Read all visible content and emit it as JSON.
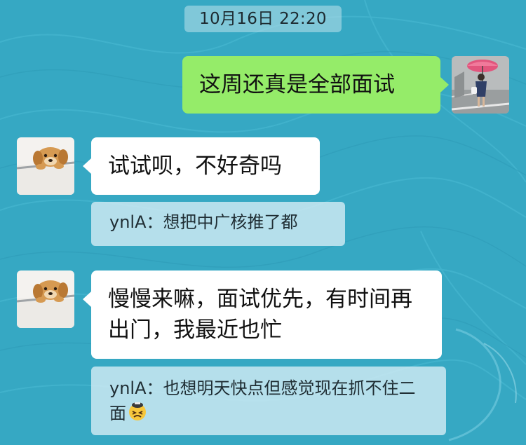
{
  "chat": {
    "timestamp": "10月16日 22:20",
    "messages": [
      {
        "direction": "outgoing",
        "text": "这周还真是全部面试",
        "avatar_icon": "umbrella-person-photo"
      },
      {
        "direction": "incoming",
        "text": "试试呗，不好奇吗",
        "avatar_icon": "puppy-photo",
        "quote": {
          "text": "ynlA：想把中广核推了都"
        }
      },
      {
        "direction": "incoming",
        "text": "慢慢来嘛，面试优先，有时间再出门，我最近也忙",
        "avatar_icon": "puppy-photo",
        "quote": {
          "text": "ynlA：也想明天快点但感觉现在抓不住二面",
          "emoji": "tired-face-emoji"
        }
      }
    ]
  },
  "colors": {
    "wallpaper": "#37a9c4",
    "outgoing_bubble": "#95ec69",
    "incoming_bubble": "#ffffff",
    "quote_bubble": "#d2ecf4"
  }
}
